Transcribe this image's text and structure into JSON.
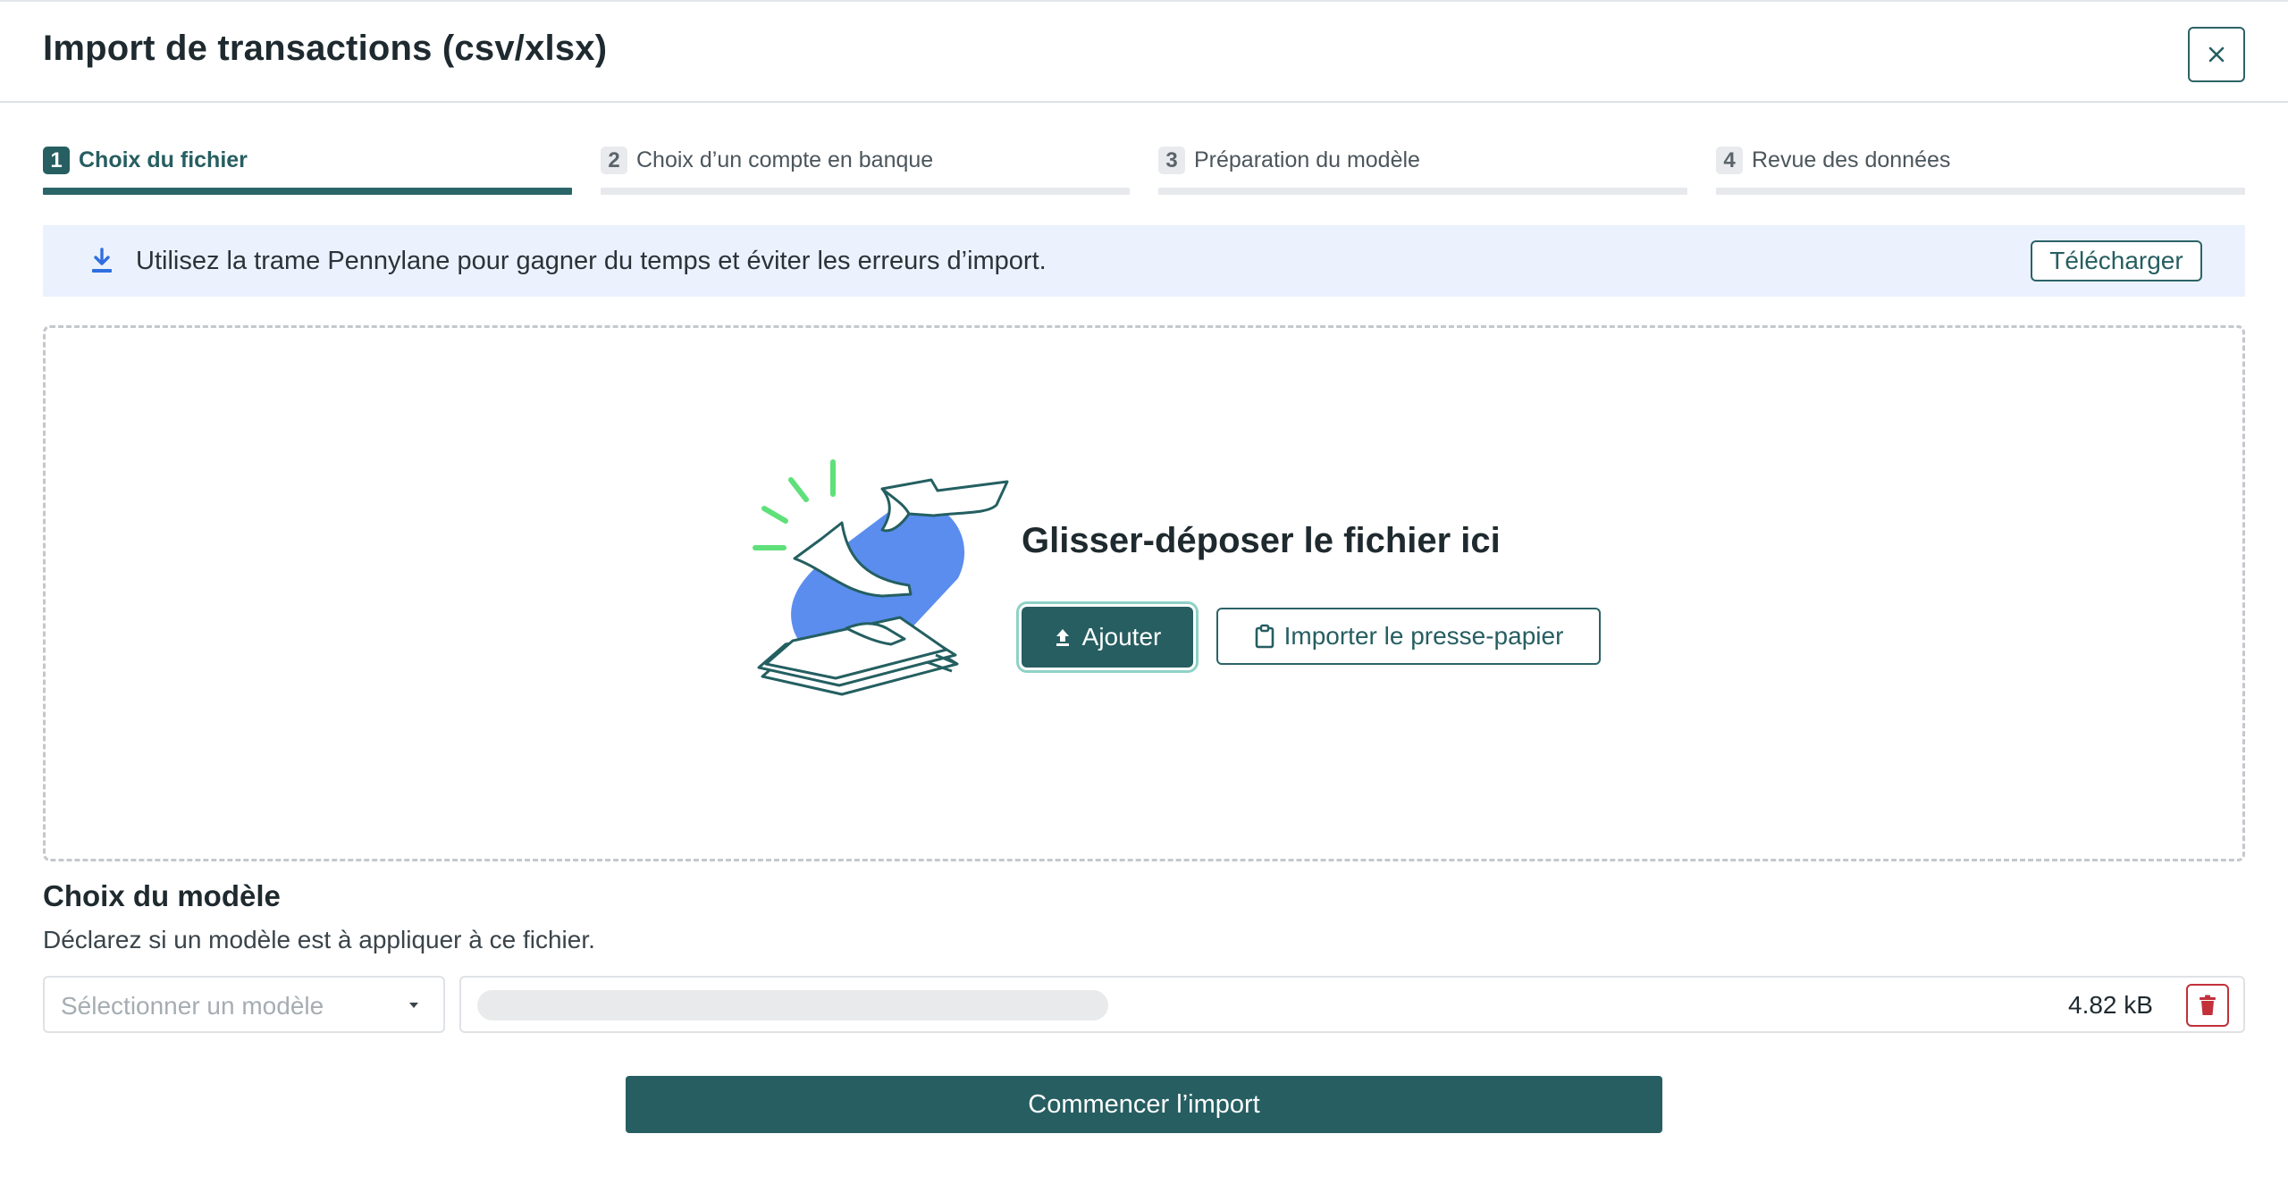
{
  "modal": {
    "title": "Import de transactions (csv/xlsx)",
    "close_icon": "close-icon"
  },
  "steps": [
    {
      "number": "1",
      "label": "Choix du fichier",
      "active": true
    },
    {
      "number": "2",
      "label": "Choix d’un compte en banque",
      "active": false
    },
    {
      "number": "3",
      "label": "Préparation du modèle",
      "active": false
    },
    {
      "number": "4",
      "label": "Revue des données",
      "active": false
    }
  ],
  "banner": {
    "icon": "download-icon",
    "text": "Utilisez la trame Pennylane pour gagner du temps et éviter les erreurs d’import.",
    "button_label": "Télécharger"
  },
  "dropzone": {
    "title": "Glisser-déposer le fichier ici",
    "add_button_label": "Ajouter",
    "add_button_icon": "upload-icon",
    "clipboard_button_label": "Importer le presse-papier",
    "clipboard_button_icon": "clipboard-icon"
  },
  "model_section": {
    "title": "Choix du modèle",
    "subtitle": "Déclarez si un modèle est à appliquer à ce fichier.",
    "select_placeholder": "Sélectionner un modèle",
    "file_size": "4.82 kB",
    "delete_icon": "trash-icon"
  },
  "footer": {
    "start_button_label": "Commencer l’import"
  },
  "colors": {
    "primary": "#265e61",
    "banner_bg": "#ebf2fe",
    "accent_blue": "#5b8def",
    "accent_green": "#5fe07a",
    "danger": "#c2303a"
  }
}
